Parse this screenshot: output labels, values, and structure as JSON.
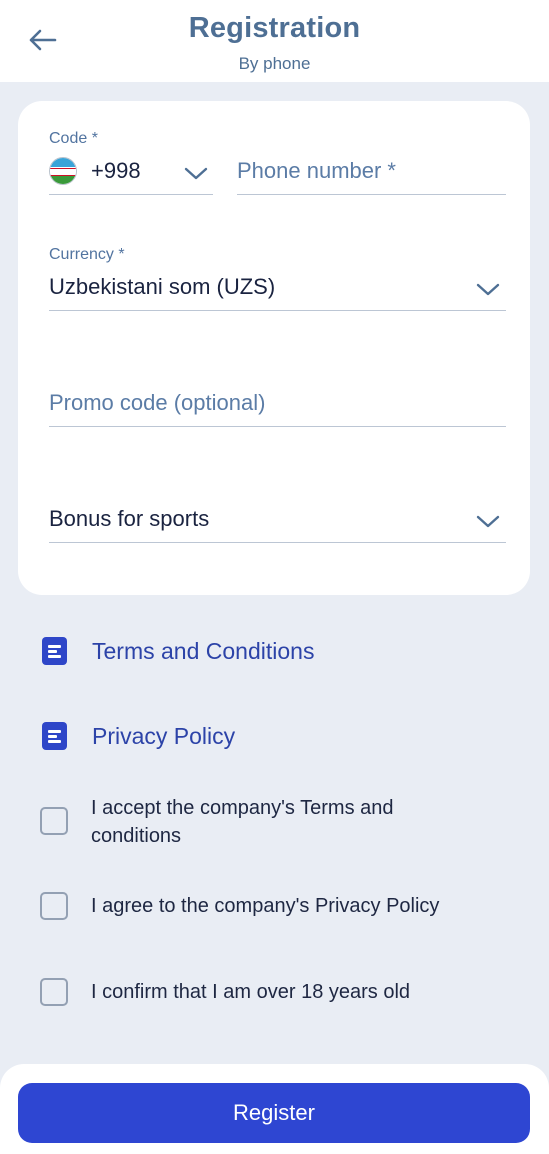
{
  "header": {
    "title": "Registration",
    "subtitle": "By phone"
  },
  "form": {
    "code_label": "Code *",
    "code_value": "+998",
    "phone_placeholder": "Phone number *",
    "currency_label": "Currency *",
    "currency_value": "Uzbekistani som (UZS)",
    "promo_placeholder": "Promo code (optional)",
    "bonus_value": "Bonus for sports"
  },
  "links": {
    "terms": "Terms and Conditions",
    "privacy": "Privacy Policy"
  },
  "checkboxes": [
    {
      "label": "I accept the company's Terms and conditions",
      "checked": false
    },
    {
      "label": "I agree to the company's Privacy Policy",
      "checked": false
    },
    {
      "label": "I confirm that I am over 18 years old",
      "checked": false
    }
  ],
  "footer": {
    "register_label": "Register"
  },
  "colors": {
    "accent": "#2e46d2",
    "header_text": "#4e6f94",
    "background": "#e9edf4"
  },
  "icons": [
    "back-arrow-icon",
    "uzbekistan-flag-icon",
    "chevron-down-icon",
    "document-icon"
  ]
}
